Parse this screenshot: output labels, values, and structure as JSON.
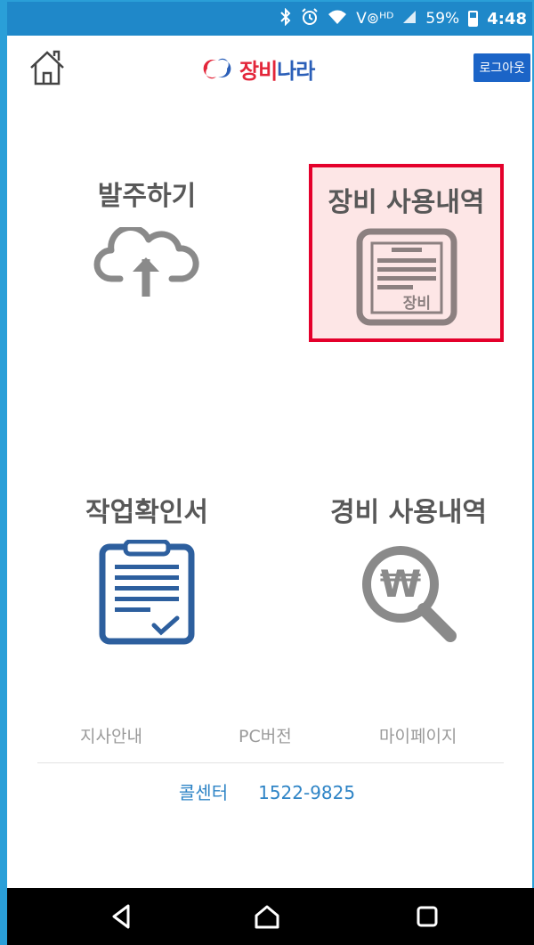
{
  "status_bar": {
    "network": "V⊚ᴴᴰ",
    "battery": "59%",
    "time": "4:48"
  },
  "header": {
    "logo_main": "장비",
    "logo_sub": "나라",
    "logout_label": "로그아웃"
  },
  "menu": [
    {
      "label": "발주하기",
      "icon": "cloud-upload-icon"
    },
    {
      "label": "장비 사용내역",
      "icon": "equipment-document-icon",
      "icon_text": "장비",
      "selected": true
    },
    {
      "label": "작업확인서",
      "icon": "clipboard-check-icon"
    },
    {
      "label": "경비 사용내역",
      "icon": "won-search-icon"
    }
  ],
  "footer": {
    "links": [
      "지사안내",
      "PC버전",
      "마이페이지"
    ],
    "callcenter_label": "콜센터",
    "callcenter_number": "1522-9825"
  },
  "colors": {
    "accent_blue": "#1f88c9",
    "highlight_red": "#e4002b",
    "highlight_bg": "#fde6e6",
    "clipboard_blue": "#2d5f9e"
  }
}
